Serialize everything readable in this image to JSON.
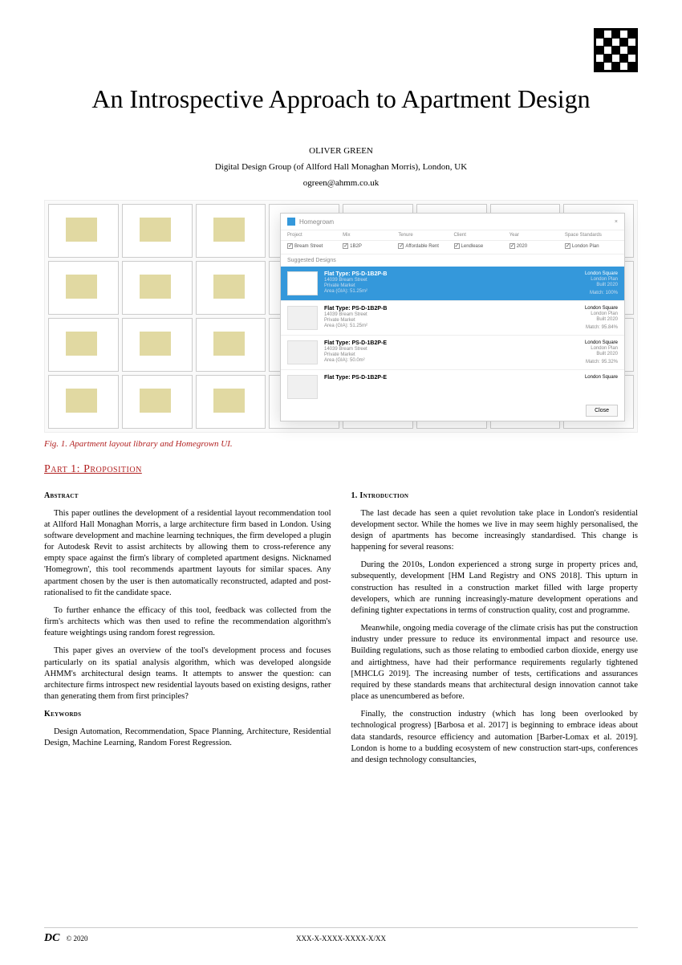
{
  "title": "An Introspective Approach to Apartment Design",
  "author": "OLIVER GREEN",
  "affiliation": "Digital Design Group (of Allford Hall Monaghan Morris), London, UK",
  "email": "ogreen@ahmm.co.uk",
  "caption": "Fig. 1. Apartment layout library and Homegrown UI.",
  "section_header": "Part 1: Proposition",
  "ui": {
    "app_name": "Homegrown",
    "close_x": "×",
    "filter_headers": {
      "project": "Project",
      "mix": "Mix",
      "tenure": "Tenure",
      "client": "Client",
      "year": "Year",
      "standards": "Space Standards"
    },
    "filter_values": {
      "project": "Bream Street",
      "mix": "1B2P",
      "tenure": "Affordable Rent",
      "client": "Lendlease",
      "year": "2020",
      "standards": "London Plan"
    },
    "suggested_label": "Suggested Designs",
    "results": [
      {
        "flat_type": "Flat Type: PS-D-1B2P-B",
        "address": "14039 Bream Street",
        "market": "Private Market",
        "area": "Area (GIA): 51.25m²",
        "client": "London Square",
        "plan": "London Plan",
        "built": "Built 2020",
        "match": "Match: 100%",
        "selected": true
      },
      {
        "flat_type": "Flat Type: PS-D-1B2P-B",
        "address": "14039 Bream Street",
        "market": "Private Market",
        "area": "Area (GIA): 51.25m²",
        "client": "London Square",
        "plan": "London Plan",
        "built": "Built 2020",
        "match": "Match: 95.84%",
        "selected": false
      },
      {
        "flat_type": "Flat Type: PS-D-1B2P-E",
        "address": "14039 Bream Street",
        "market": "Private Market",
        "area": "Area (GIA): 50.0m²",
        "client": "London Square",
        "plan": "London Plan",
        "built": "Built 2020",
        "match": "Match: 95.32%",
        "selected": false
      },
      {
        "flat_type": "Flat Type: PS-D-1B2P-E",
        "address": "",
        "market": "",
        "area": "",
        "client": "London Square",
        "plan": "",
        "built": "",
        "match": "",
        "selected": false
      }
    ],
    "close_button": "Close"
  },
  "left_col": {
    "abstract_header": "Abstract",
    "abstract_p1": "This paper outlines the development of a residential layout recommendation tool at Allford Hall Monaghan Morris, a large architecture firm based in London. Using software development and machine learning techniques, the firm developed a plugin for Autodesk Revit to assist architects by allowing them to cross-reference any empty space against the firm's library of completed apartment designs. Nicknamed 'Homegrown', this tool recommends apartment layouts for similar spaces. Any apartment chosen by the user is then automatically reconstructed, adapted and post-rationalised to fit the candidate space.",
    "abstract_p2": "To further enhance the efficacy of this tool, feedback was collected from the firm's architects which was then used to refine the recommendation algorithm's feature weightings using random forest regression.",
    "abstract_p3": "This paper gives an overview of the tool's development process and focuses particularly on its spatial analysis algorithm, which was developed alongside AHMM's architectural design teams. It attempts to answer the question: can architecture firms introspect new residential layouts based on existing designs, rather than generating them from first principles?",
    "keywords_header": "Keywords",
    "keywords": "Design Automation, Recommendation, Space Planning, Architecture, Residential Design, Machine Learning, Random Forest Regression."
  },
  "right_col": {
    "intro_header": "1. Introduction",
    "intro_p1": "The last decade has seen a quiet revolution take place in London's residential development sector. While the homes we live in may seem highly personalised, the design of apartments has become increasingly standardised. This change is happening for several reasons:",
    "intro_p2": "During the 2010s, London experienced a strong surge in property prices and, subsequently, development [HM Land Registry and ONS 2018]. This upturn in construction has resulted in a construction market filled with large property developers, which are running increasingly-mature development operations and defining tighter expectations in terms of construction quality, cost and programme.",
    "intro_p3": "Meanwhile, ongoing media coverage of the climate crisis has put the construction industry under pressure to reduce its environmental impact and resource use. Building regulations, such as those relating to embodied carbon dioxide, energy use and airtightness, have had their performance requirements regularly tightened [MHCLG 2019]. The increasing number of tests, certifications and assurances required by these standards means that architectural design innovation cannot take place as unencumbered as before.",
    "intro_p4": "Finally, the construction industry (which has long been overlooked by technological progress) [Barbosa et al. 2017] is beginning to embrace ideas about data standards, resource efficiency and automation [Barber-Lomax et al. 2019]. London is home to a budding ecosystem of new construction start-ups, conferences and design technology consultancies,"
  },
  "footer": {
    "logo": "DC",
    "copyright": "© 2020",
    "code": "XXX-X-XXXX-XXXX-X/XX"
  }
}
